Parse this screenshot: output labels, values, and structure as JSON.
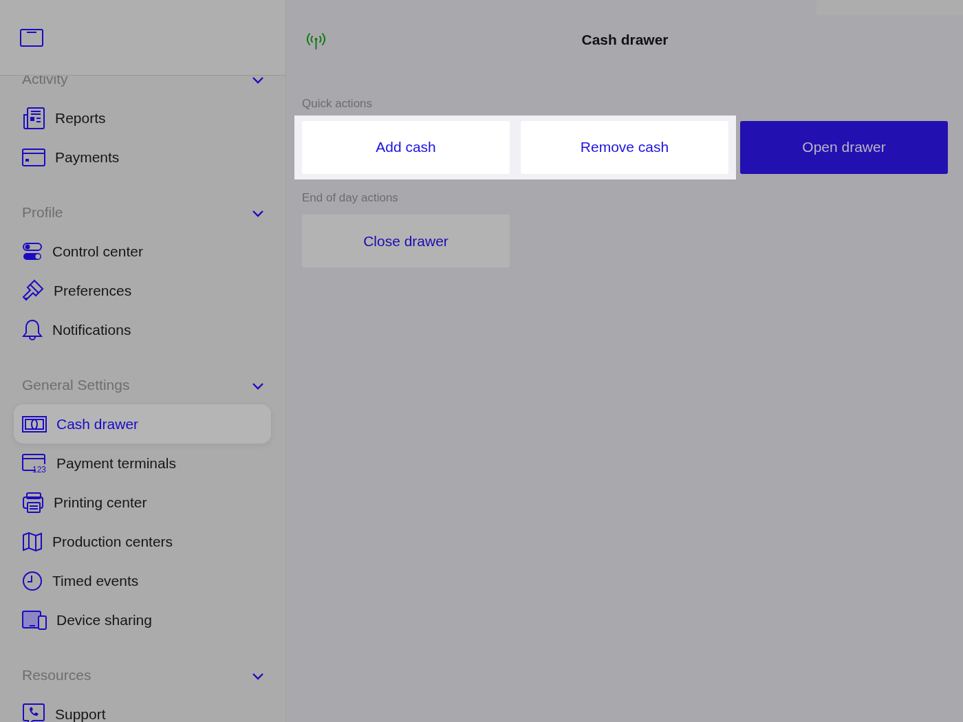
{
  "sidebar": {
    "groups": [
      {
        "title": "Activity",
        "expanded": true,
        "items": [
          {
            "label": "Reports",
            "selected": false
          },
          {
            "label": "Payments",
            "selected": false
          }
        ]
      },
      {
        "title": "Profile",
        "expanded": true,
        "items": [
          {
            "label": "Control center",
            "selected": false
          },
          {
            "label": "Preferences",
            "selected": false
          },
          {
            "label": "Notifications",
            "selected": false
          }
        ]
      },
      {
        "title": "General Settings",
        "expanded": true,
        "items": [
          {
            "label": "Cash drawer",
            "selected": true
          },
          {
            "label": "Payment terminals",
            "selected": false,
            "icon_text": "123"
          },
          {
            "label": "Printing center",
            "selected": false
          },
          {
            "label": "Production centers",
            "selected": false
          },
          {
            "label": "Timed events",
            "selected": false
          },
          {
            "label": "Device sharing",
            "selected": false
          }
        ]
      },
      {
        "title": "Resources",
        "expanded": true,
        "items": [
          {
            "label": "Support",
            "selected": false
          }
        ]
      }
    ]
  },
  "header": {
    "title": "Cash drawer"
  },
  "sections": [
    {
      "title": "Quick actions",
      "buttons": [
        {
          "label": "Add cash",
          "kind": "secondary",
          "highlighted": true
        },
        {
          "label": "Remove cash",
          "kind": "secondary",
          "highlighted": true
        },
        {
          "label": "Open drawer",
          "kind": "primary",
          "highlighted": false
        }
      ]
    },
    {
      "title": "End of day actions",
      "buttons": [
        {
          "label": "Close drawer",
          "kind": "secondary",
          "highlighted": false
        }
      ]
    }
  ]
}
